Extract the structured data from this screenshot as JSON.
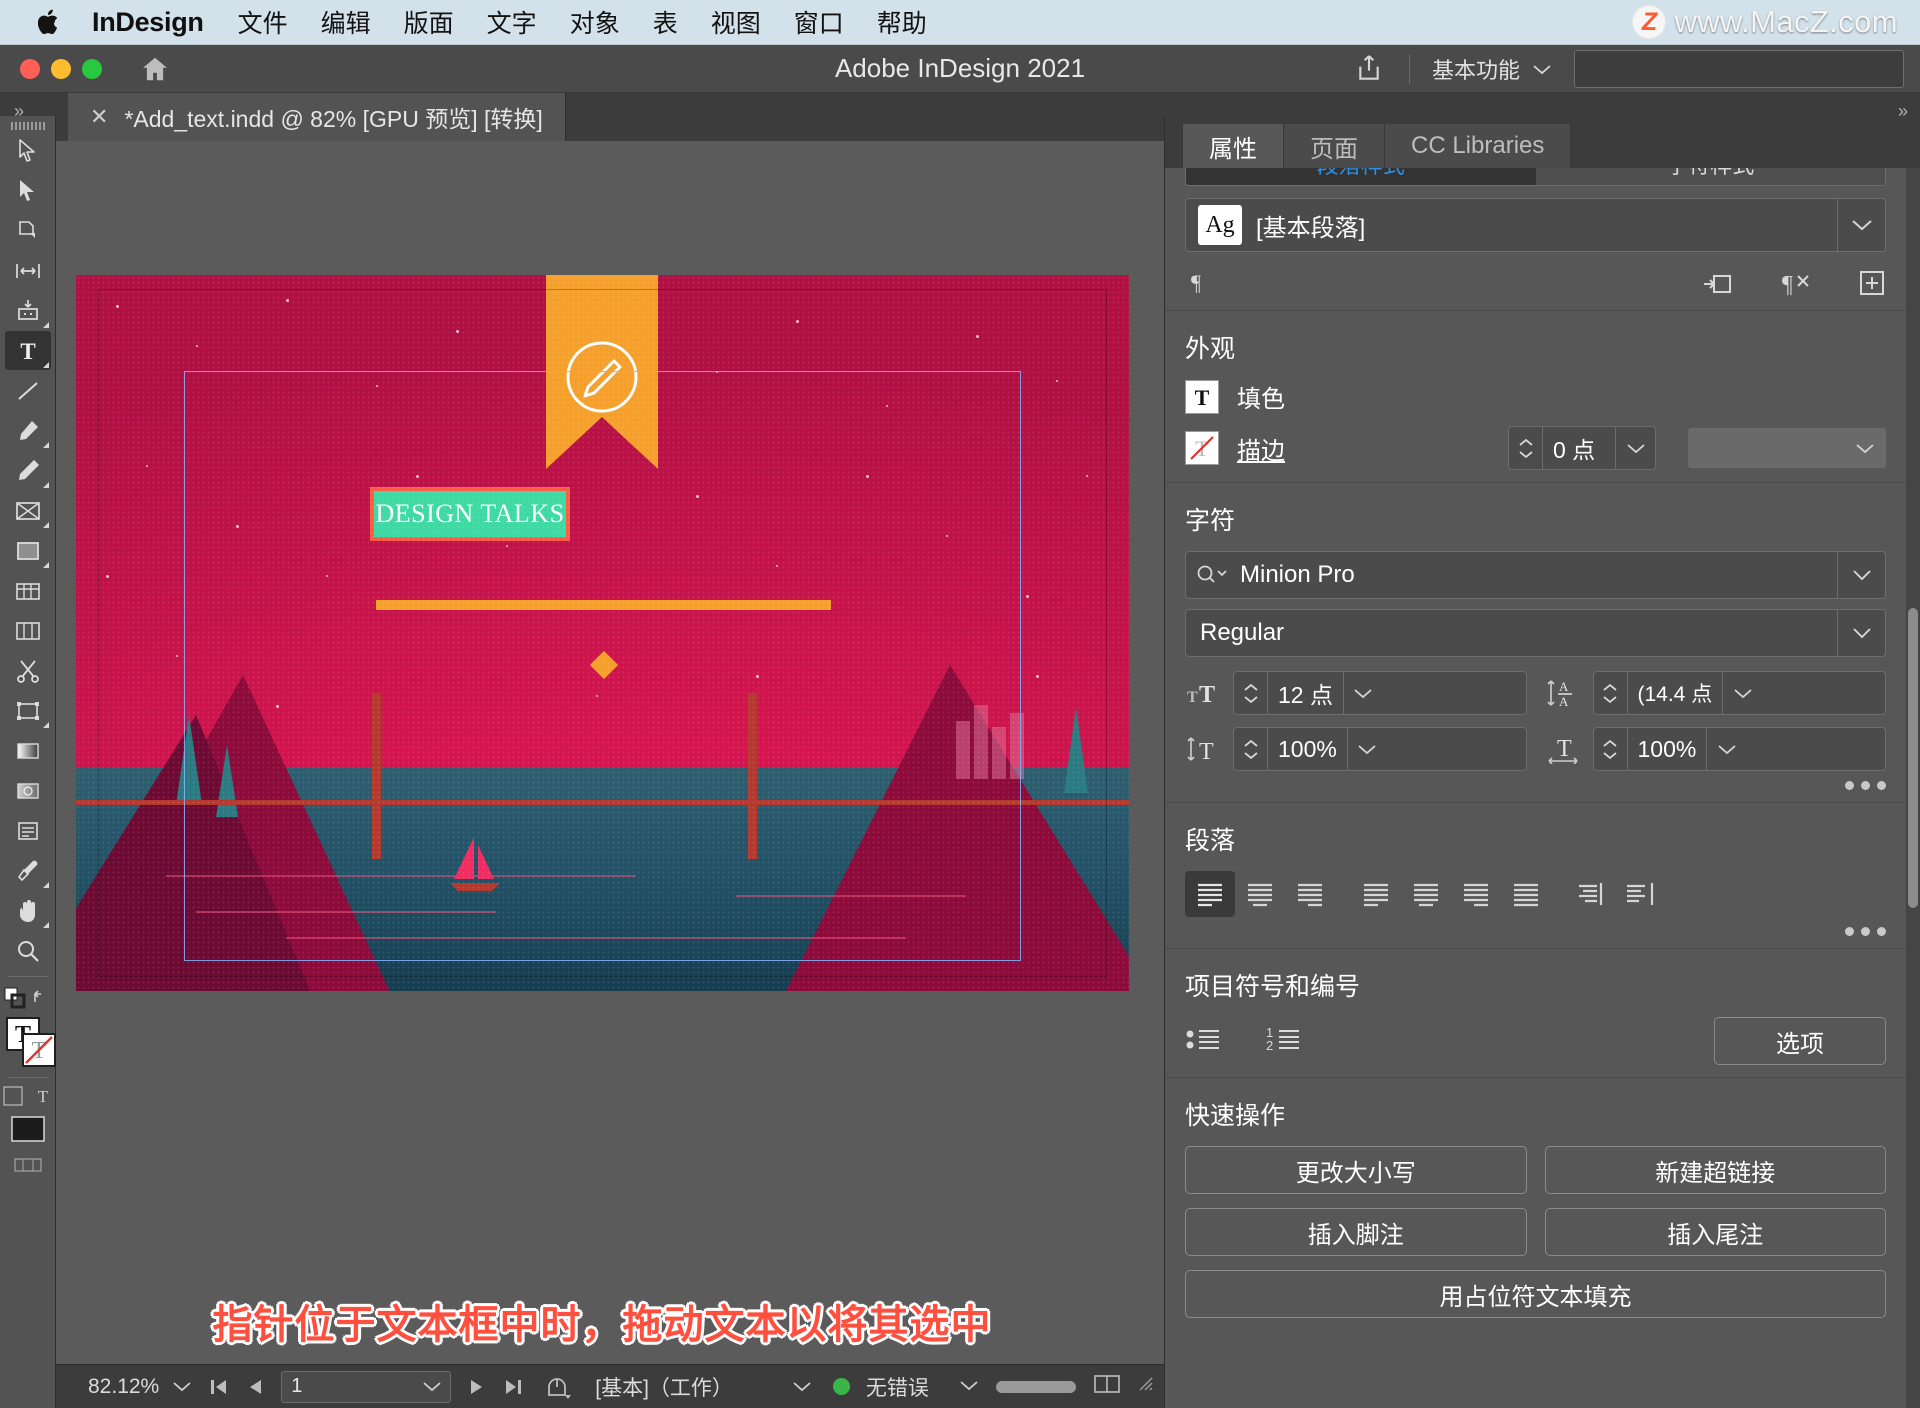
{
  "menubar": {
    "apple_icon": "apple-logo-icon",
    "app_name": "InDesign",
    "items": [
      "文件",
      "编辑",
      "版面",
      "文字",
      "对象",
      "表",
      "视图",
      "窗口",
      "帮助"
    ],
    "watermark_badge": "Z",
    "watermark_text": "www.MacZ.com"
  },
  "titlebar": {
    "title": "Adobe InDesign 2021",
    "home_icon": "home-icon",
    "share_icon": "share-icon",
    "workspace": "基本功能",
    "search_placeholder": ""
  },
  "tab": {
    "close": "✕",
    "label": "*Add_text.indd @ 82% [GPU 预览] [转换]"
  },
  "toolbar": {
    "tools": [
      {
        "name": "selection-tool",
        "active": false
      },
      {
        "name": "direct-selection-tool",
        "active": false
      },
      {
        "name": "page-tool",
        "active": false
      },
      {
        "name": "gap-tool",
        "active": false
      },
      {
        "name": "content-collector-tool",
        "active": false
      },
      {
        "name": "type-tool",
        "active": true
      },
      {
        "name": "line-tool",
        "active": false
      },
      {
        "name": "pen-tool",
        "active": false
      },
      {
        "name": "pencil-tool",
        "active": false
      },
      {
        "name": "frame-tool",
        "active": false
      },
      {
        "name": "rectangle-tool",
        "active": false
      },
      {
        "name": "table-tool",
        "active": false
      },
      {
        "name": "column-tool",
        "active": false
      },
      {
        "name": "scissors-tool",
        "active": false
      },
      {
        "name": "free-transform-tool",
        "active": false
      },
      {
        "name": "gradient-swatch-tool",
        "active": false
      },
      {
        "name": "gradient-feather-tool",
        "active": false
      },
      {
        "name": "note-tool",
        "active": false
      },
      {
        "name": "eyedropper-tool",
        "active": false
      },
      {
        "name": "hand-tool",
        "active": false
      },
      {
        "name": "zoom-tool",
        "active": false
      }
    ]
  },
  "canvas": {
    "poster_title": "DESIGN TALKS",
    "annotation": "指针位于文本框中时，拖动文本以将其选中",
    "colors": {
      "poster_bg": "#c4134d",
      "selection_highlight": "#3fd9a4",
      "frame_border": "#fb5d46",
      "ribbon": "#f5a02c",
      "water": "#27566a",
      "annotation_text": "#ff4f3f"
    }
  },
  "statusbar": {
    "zoom": "82.12%",
    "page": "1",
    "first_icon": "first-page-icon",
    "prev_icon": "previous-page-icon",
    "next_icon": "next-page-icon",
    "last_icon": "last-page-icon",
    "preflight_icon": "preflight-icon",
    "master": "[基本]（工作）",
    "errors": "无错误",
    "error_color": "#3ab54a"
  },
  "rightpanel": {
    "tabs": [
      {
        "label": "属性",
        "active": true
      },
      {
        "label": "页面",
        "active": false
      },
      {
        "label": "CC Libraries",
        "active": false
      }
    ],
    "style_row": [
      "段落样式",
      "字符样式"
    ],
    "paragraph_style": {
      "swatch": "Ag",
      "value": "[基本段落]"
    },
    "style_icons": [
      "paragraph-mark-icon",
      "insert-into-frame-icon",
      "clear-overrides-icon",
      "new-style-icon"
    ],
    "appearance": {
      "title": "外观",
      "fill_label": "填色",
      "fill_icon": "text-fill-icon",
      "stroke_label": "描边",
      "stroke_icon": "stroke-none-icon",
      "stroke_weight": "0 点",
      "stroke_type": ""
    },
    "character": {
      "title": "字符",
      "font_family": "Minion Pro",
      "font_style": "Regular",
      "font_size": "12 点",
      "font_size_icon": "font-size-icon",
      "leading": "(14.4 点",
      "leading_icon": "leading-icon",
      "vertical_scale": "100%",
      "vertical_scale_icon": "vertical-scale-icon",
      "horizontal_scale": "100%",
      "horizontal_scale_icon": "horizontal-scale-icon"
    },
    "paragraph": {
      "title": "段落",
      "align_buttons": [
        "align-left",
        "align-center",
        "align-right",
        "justify-left",
        "justify-center",
        "justify-right",
        "justify-all",
        "align-toward-spine",
        "align-away-spine"
      ],
      "active_align": 0,
      "more_icon": "more-options-icon"
    },
    "bullets": {
      "title": "项目符号和编号",
      "bullet_icon": "bulleted-list-icon",
      "number_icon": "numbered-list-icon",
      "options_label": "选项"
    },
    "quick_actions": {
      "title": "快速操作",
      "buttons": [
        "更改大小写",
        "新建超链接",
        "插入脚注",
        "插入尾注"
      ],
      "full_button": "用占位符文本填充"
    }
  }
}
